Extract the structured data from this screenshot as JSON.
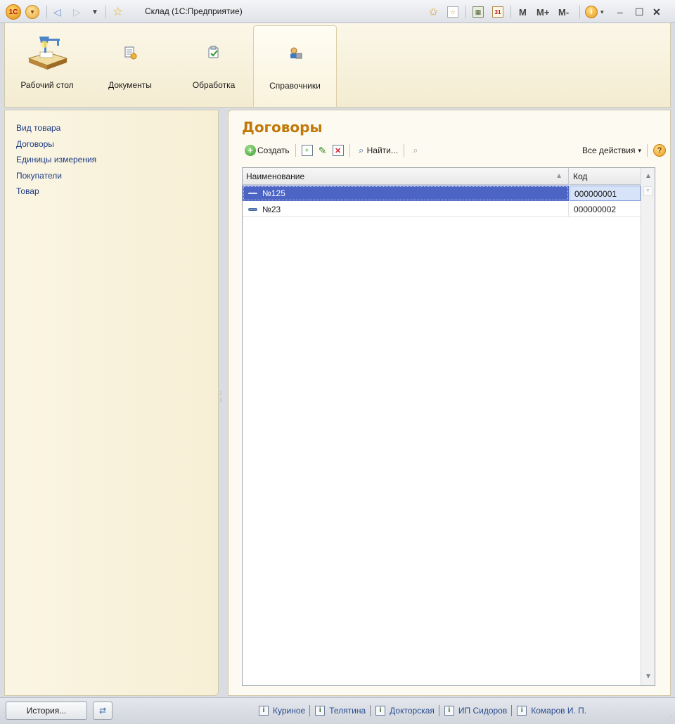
{
  "window": {
    "title": "Склад  (1С:Предприятие)",
    "logo_text": "1С",
    "right_tools": [
      "M",
      "M+",
      "M-"
    ]
  },
  "sections": [
    {
      "label": "Рабочий стол",
      "icon": "desktop-lamp-icon"
    },
    {
      "label": "Документы",
      "icon": "documents-icon"
    },
    {
      "label": "Обработка",
      "icon": "processing-icon"
    },
    {
      "label": "Справочники",
      "icon": "catalogs-icon",
      "active": true
    }
  ],
  "sidebar": {
    "items": [
      {
        "label": "Вид товара"
      },
      {
        "label": "Договоры"
      },
      {
        "label": "Единицы измерения"
      },
      {
        "label": "Покупатели"
      },
      {
        "label": "Товар"
      }
    ]
  },
  "form": {
    "title": "Договоры",
    "commands": {
      "create": "Создать",
      "find": "Найти...",
      "all_actions": "Все действия"
    },
    "table": {
      "columns": [
        "Наименование",
        "Код"
      ],
      "rows": [
        {
          "name": "№125",
          "code": "000000001",
          "selected": true
        },
        {
          "name": "№23",
          "code": "000000002",
          "selected": false
        }
      ]
    }
  },
  "statusbar": {
    "history_label": "История...",
    "links": [
      "Куриное",
      "Телятина",
      "Докторская",
      "ИП Сидоров",
      "Комаров И. П."
    ]
  },
  "colors": {
    "accent_title": "#c0790a",
    "selection": "#4c64c4",
    "panel_bg": "#f7efd5"
  }
}
